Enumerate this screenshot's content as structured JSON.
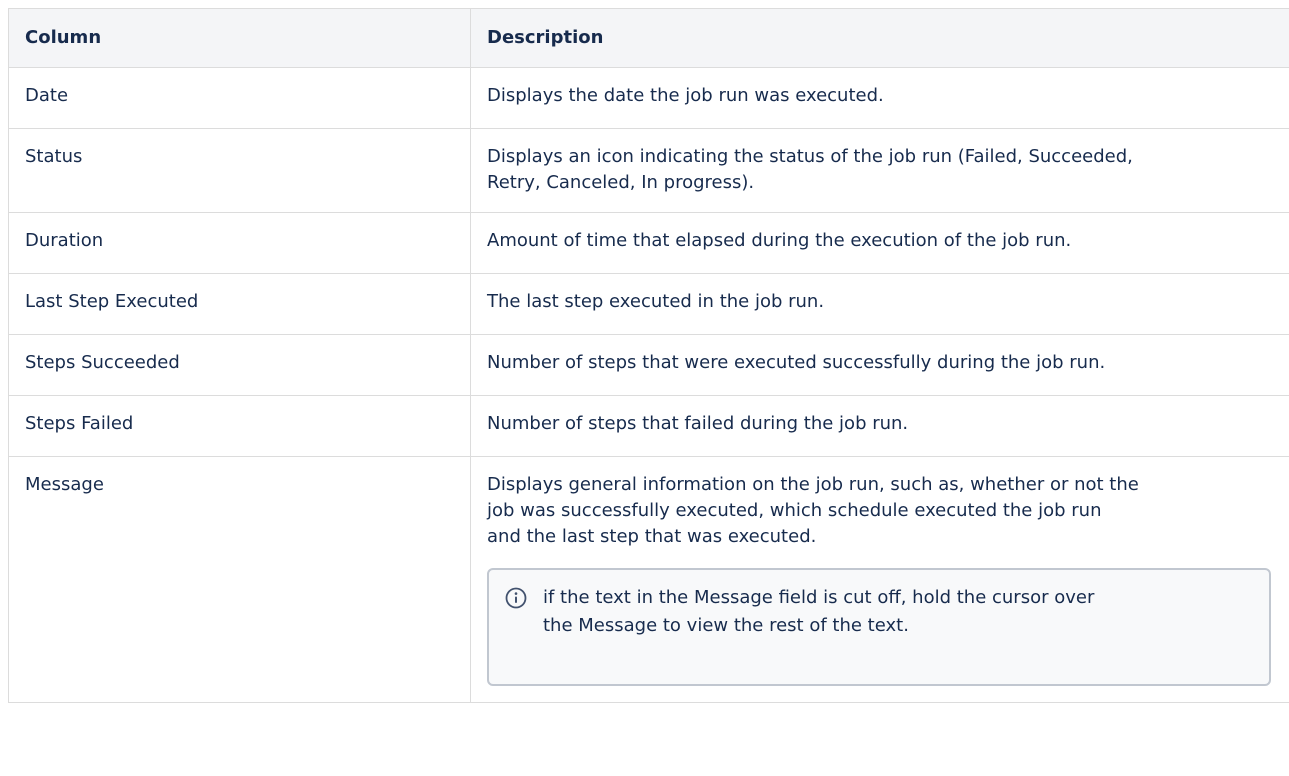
{
  "table": {
    "headers": {
      "column": "Column",
      "description": "Description"
    },
    "rows": [
      {
        "column": "Date",
        "description": [
          "Displays the date the job run was executed."
        ]
      },
      {
        "column": "Status",
        "description": [
          "Displays an icon indicating the status of the job run (Failed, Succeeded,",
          "Retry, Canceled, In progress)."
        ]
      },
      {
        "column": "Duration",
        "description": [
          "Amount of time that elapsed during the execution of the job run."
        ]
      },
      {
        "column": "Last Step Executed",
        "description": [
          "The last step executed in the job run."
        ]
      },
      {
        "column": "Steps Succeeded",
        "description": [
          "Number of steps that were executed successfully during the job run."
        ]
      },
      {
        "column": "Steps Failed",
        "description": [
          "Number of steps that failed during the job run."
        ]
      },
      {
        "column": "Message",
        "description": [
          "Displays general information on the job run, such as, whether or not the",
          "job was successfully executed, which schedule executed the job run",
          "and the last step that was executed."
        ],
        "note": {
          "icon": "info-icon",
          "lines": [
            "if the text in the Message field is cut off, hold the cursor over",
            "the Message to view the rest of the text."
          ]
        }
      }
    ]
  },
  "colors": {
    "header_bg": "#f4f5f7",
    "border": "#dcdcdc",
    "note_border": "#c1c7d0",
    "text": "#172b4d"
  }
}
